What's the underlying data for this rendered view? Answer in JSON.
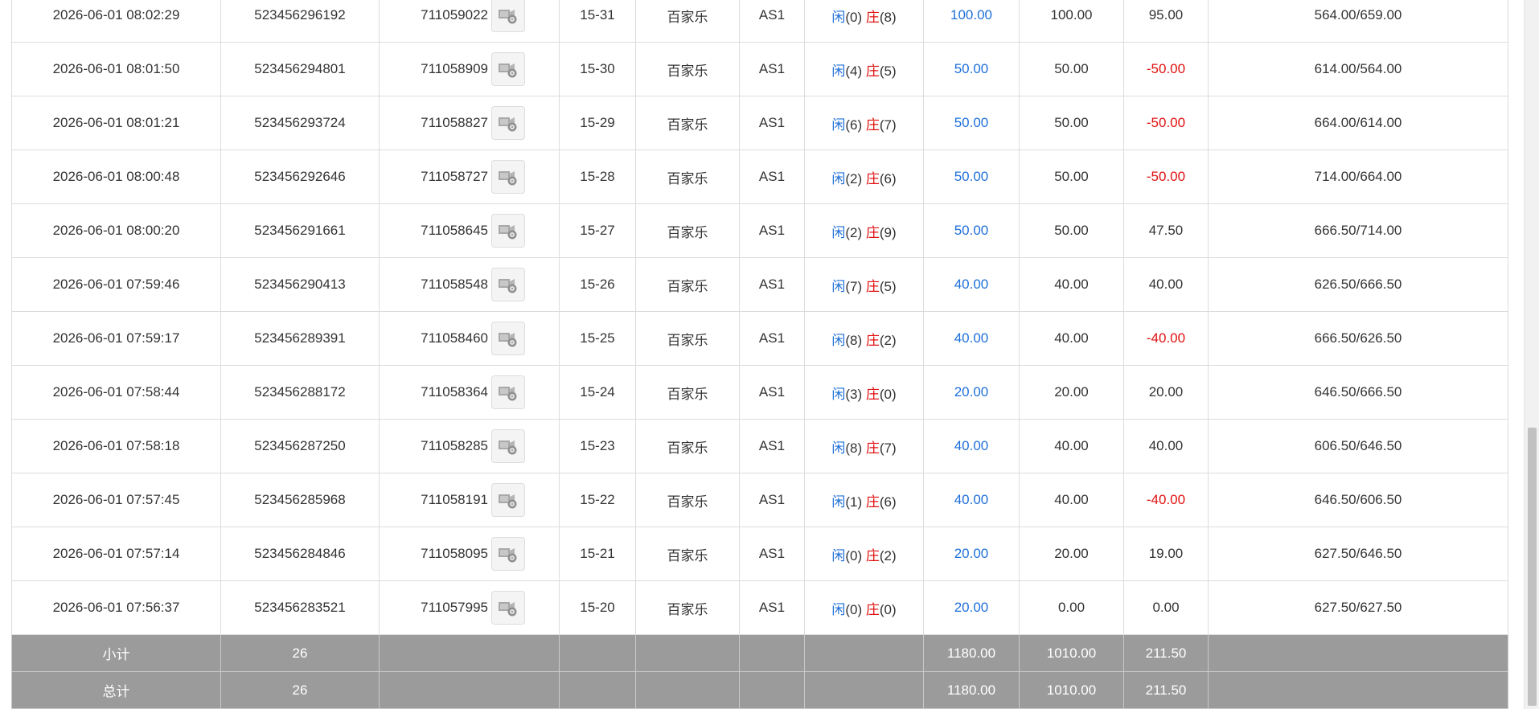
{
  "table": {
    "rows": [
      {
        "time": "2026-06-01 08:02:29",
        "order_no": "523456296192",
        "round_no": "711059022",
        "table_no": "15-31",
        "game": "百家乐",
        "table_code": "AS1",
        "result": {
          "player_label": "闲",
          "player_score": "(0)",
          "banker_label": "庄",
          "banker_score": "(8)"
        },
        "bet": "100.00",
        "valid_bet": "100.00",
        "win_loss": "95.00",
        "balance": "564.00/659.00"
      },
      {
        "time": "2026-06-01 08:01:50",
        "order_no": "523456294801",
        "round_no": "711058909",
        "table_no": "15-30",
        "game": "百家乐",
        "table_code": "AS1",
        "result": {
          "player_label": "闲",
          "player_score": "(4)",
          "banker_label": "庄",
          "banker_score": "(5)"
        },
        "bet": "50.00",
        "valid_bet": "50.00",
        "win_loss": "-50.00",
        "balance": "614.00/564.00"
      },
      {
        "time": "2026-06-01 08:01:21",
        "order_no": "523456293724",
        "round_no": "711058827",
        "table_no": "15-29",
        "game": "百家乐",
        "table_code": "AS1",
        "result": {
          "player_label": "闲",
          "player_score": "(6)",
          "banker_label": "庄",
          "banker_score": "(7)"
        },
        "bet": "50.00",
        "valid_bet": "50.00",
        "win_loss": "-50.00",
        "balance": "664.00/614.00"
      },
      {
        "time": "2026-06-01 08:00:48",
        "order_no": "523456292646",
        "round_no": "711058727",
        "table_no": "15-28",
        "game": "百家乐",
        "table_code": "AS1",
        "result": {
          "player_label": "闲",
          "player_score": "(2)",
          "banker_label": "庄",
          "banker_score": "(6)"
        },
        "bet": "50.00",
        "valid_bet": "50.00",
        "win_loss": "-50.00",
        "balance": "714.00/664.00"
      },
      {
        "time": "2026-06-01 08:00:20",
        "order_no": "523456291661",
        "round_no": "711058645",
        "table_no": "15-27",
        "game": "百家乐",
        "table_code": "AS1",
        "result": {
          "player_label": "闲",
          "player_score": "(2)",
          "banker_label": "庄",
          "banker_score": "(9)"
        },
        "bet": "50.00",
        "valid_bet": "50.00",
        "win_loss": "47.50",
        "balance": "666.50/714.00"
      },
      {
        "time": "2026-06-01 07:59:46",
        "order_no": "523456290413",
        "round_no": "711058548",
        "table_no": "15-26",
        "game": "百家乐",
        "table_code": "AS1",
        "result": {
          "player_label": "闲",
          "player_score": "(7)",
          "banker_label": "庄",
          "banker_score": "(5)"
        },
        "bet": "40.00",
        "valid_bet": "40.00",
        "win_loss": "40.00",
        "balance": "626.50/666.50"
      },
      {
        "time": "2026-06-01 07:59:17",
        "order_no": "523456289391",
        "round_no": "711058460",
        "table_no": "15-25",
        "game": "百家乐",
        "table_code": "AS1",
        "result": {
          "player_label": "闲",
          "player_score": "(8)",
          "banker_label": "庄",
          "banker_score": "(2)"
        },
        "bet": "40.00",
        "valid_bet": "40.00",
        "win_loss": "-40.00",
        "balance": "666.50/626.50"
      },
      {
        "time": "2026-06-01 07:58:44",
        "order_no": "523456288172",
        "round_no": "711058364",
        "table_no": "15-24",
        "game": "百家乐",
        "table_code": "AS1",
        "result": {
          "player_label": "闲",
          "player_score": "(3)",
          "banker_label": "庄",
          "banker_score": "(0)"
        },
        "bet": "20.00",
        "valid_bet": "20.00",
        "win_loss": "20.00",
        "balance": "646.50/666.50"
      },
      {
        "time": "2026-06-01 07:58:18",
        "order_no": "523456287250",
        "round_no": "711058285",
        "table_no": "15-23",
        "game": "百家乐",
        "table_code": "AS1",
        "result": {
          "player_label": "闲",
          "player_score": "(8)",
          "banker_label": "庄",
          "banker_score": "(7)"
        },
        "bet": "40.00",
        "valid_bet": "40.00",
        "win_loss": "40.00",
        "balance": "606.50/646.50"
      },
      {
        "time": "2026-06-01 07:57:45",
        "order_no": "523456285968",
        "round_no": "711058191",
        "table_no": "15-22",
        "game": "百家乐",
        "table_code": "AS1",
        "result": {
          "player_label": "闲",
          "player_score": "(1)",
          "banker_label": "庄",
          "banker_score": "(6)"
        },
        "bet": "40.00",
        "valid_bet": "40.00",
        "win_loss": "-40.00",
        "balance": "646.50/606.50"
      },
      {
        "time": "2026-06-01 07:57:14",
        "order_no": "523456284846",
        "round_no": "711058095",
        "table_no": "15-21",
        "game": "百家乐",
        "table_code": "AS1",
        "result": {
          "player_label": "闲",
          "player_score": "(0)",
          "banker_label": "庄",
          "banker_score": "(2)"
        },
        "bet": "20.00",
        "valid_bet": "20.00",
        "win_loss": "19.00",
        "balance": "627.50/646.50"
      },
      {
        "time": "2026-06-01 07:56:37",
        "order_no": "523456283521",
        "round_no": "711057995",
        "table_no": "15-20",
        "game": "百家乐",
        "table_code": "AS1",
        "result": {
          "player_label": "闲",
          "player_score": "(0)",
          "banker_label": "庄",
          "banker_score": "(0)"
        },
        "bet": "20.00",
        "valid_bet": "0.00",
        "win_loss": "0.00",
        "balance": "627.50/627.50"
      }
    ],
    "subtotal": {
      "label": "小计",
      "count": "26",
      "bet": "1180.00",
      "valid_bet": "1010.00",
      "win_loss": "211.50"
    },
    "total": {
      "label": "总计",
      "count": "26",
      "bet": "1180.00",
      "valid_bet": "1010.00",
      "win_loss": "211.50"
    }
  },
  "icons": {
    "replay": "video-replay-icon"
  },
  "colors": {
    "bet_text": "#1e6fd9",
    "player_text": "#1e6fd9",
    "banker_text": "#e01010",
    "loss_text": "#e01010",
    "summary_bg": "#9b9b9b"
  }
}
